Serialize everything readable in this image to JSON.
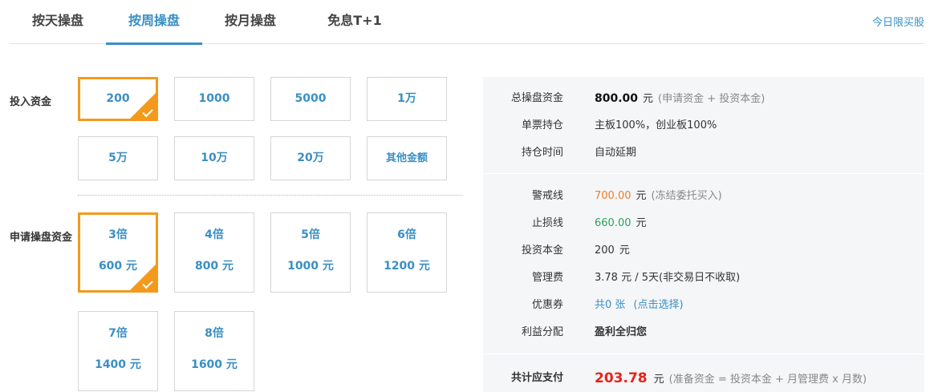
{
  "tabs": [
    {
      "label": "按天操盘"
    },
    {
      "label": "按周操盘"
    },
    {
      "label": "按月操盘"
    },
    {
      "label": "免息T+1"
    }
  ],
  "active_tab": "按周操盘",
  "limit_link": "今日限买股",
  "invest": {
    "label": "投入资金",
    "selected": "200",
    "options": [
      "200",
      "1000",
      "5000",
      "1万",
      "5万",
      "10万",
      "20万",
      "其他金额"
    ]
  },
  "leverage": {
    "label": "申请操盘资金",
    "selected": "3倍",
    "options": [
      {
        "multiple": "3倍",
        "amount": "600 元"
      },
      {
        "multiple": "4倍",
        "amount": "800 元"
      },
      {
        "multiple": "5倍",
        "amount": "1000 元"
      },
      {
        "multiple": "6倍",
        "amount": "1200 元"
      },
      {
        "multiple": "7倍",
        "amount": "1400 元"
      },
      {
        "multiple": "8倍",
        "amount": "1600 元"
      }
    ]
  },
  "summary": {
    "total_capital": {
      "label": "总操盘资金",
      "value": "800.00",
      "unit": "元",
      "note": "(申请资金 + 投资本金)"
    },
    "single_stock": {
      "label": "单票持仓",
      "value": "主板100%，创业板100%"
    },
    "hold_time": {
      "label": "持仓时间",
      "value": "自动延期"
    },
    "warning_line": {
      "label": "警戒线",
      "value": "700.00",
      "unit": "元",
      "note": "(冻结委托买入)"
    },
    "stop_loss": {
      "label": "止损线",
      "value": "660.00",
      "unit": "元"
    },
    "principal": {
      "label": "投资本金",
      "value": "200",
      "unit": "元"
    },
    "management_fee": {
      "label": "管理费",
      "value": "3.78 元 / 5天",
      "note": "(非交易日不收取)"
    },
    "coupon": {
      "label": "优惠券",
      "value": "共0 张",
      "note": "(点击选择)"
    },
    "profit_share": {
      "label": "利益分配",
      "value": "盈利全归您"
    },
    "total_pay": {
      "label": "共计应支付",
      "value": "203.78",
      "unit": "元",
      "note": "(准备资金 = 投资本金 + 月管理费 x 月数)"
    }
  },
  "colors": {
    "accent_blue": "#3a8fc4",
    "selected_orange": "#f39a1c",
    "warning_orange": "#f07c29",
    "stop_green": "#2aa35a",
    "total_red": "#e8221a",
    "summary_bg": "#f5f6f8"
  }
}
